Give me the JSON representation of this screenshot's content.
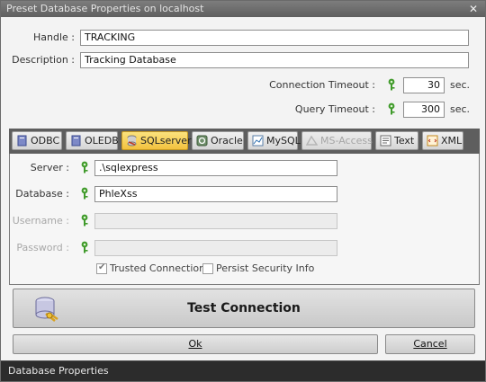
{
  "window": {
    "title": "Preset Database Properties on localhost",
    "close_glyph": "✕"
  },
  "general": {
    "handle_label": "Handle :",
    "handle_value": "TRACKING",
    "description_label": "Description :",
    "description_value": "Tracking Database",
    "connection_timeout_label": "Connection Timeout :",
    "connection_timeout_value": "30",
    "query_timeout_label": "Query Timeout :",
    "query_timeout_value": "300",
    "unit": "sec."
  },
  "tabs": [
    {
      "label": "ODBC",
      "icon": "odbc-icon",
      "state": "normal"
    },
    {
      "label": "OLEDB",
      "icon": "oledb-icon",
      "state": "normal"
    },
    {
      "label": "SQLserver",
      "icon": "sqlserver-icon",
      "state": "active"
    },
    {
      "label": "Oracle",
      "icon": "oracle-icon",
      "state": "normal"
    },
    {
      "label": "MySQL",
      "icon": "mysql-icon",
      "state": "normal"
    },
    {
      "label": "MS-Access",
      "icon": "ms-access-icon",
      "state": "disabled"
    },
    {
      "label": "Text",
      "icon": "text-icon",
      "state": "normal"
    },
    {
      "label": "XML",
      "icon": "xml-icon",
      "state": "normal"
    }
  ],
  "sqlserver": {
    "server_label": "Server :",
    "server_value": ".\\sqlexpress",
    "database_label": "Database :",
    "database_value": "PhleXss",
    "username_label": "Username :",
    "username_value": "",
    "password_label": "Password :",
    "password_value": "",
    "trusted_connection_label": "Trusted Connection",
    "trusted_connection_checked": true,
    "persist_security_label": "Persist Security Info",
    "persist_security_checked": false
  },
  "actions": {
    "test_connection_label": "Test Connection",
    "ok_label": "Ok",
    "cancel_label": "Cancel"
  },
  "status": {
    "text": "Database Properties"
  },
  "colors": {
    "active_tab": "#f3c23f",
    "key_icon": "#3f9a2a",
    "status_bar": "#2c2c2c"
  }
}
